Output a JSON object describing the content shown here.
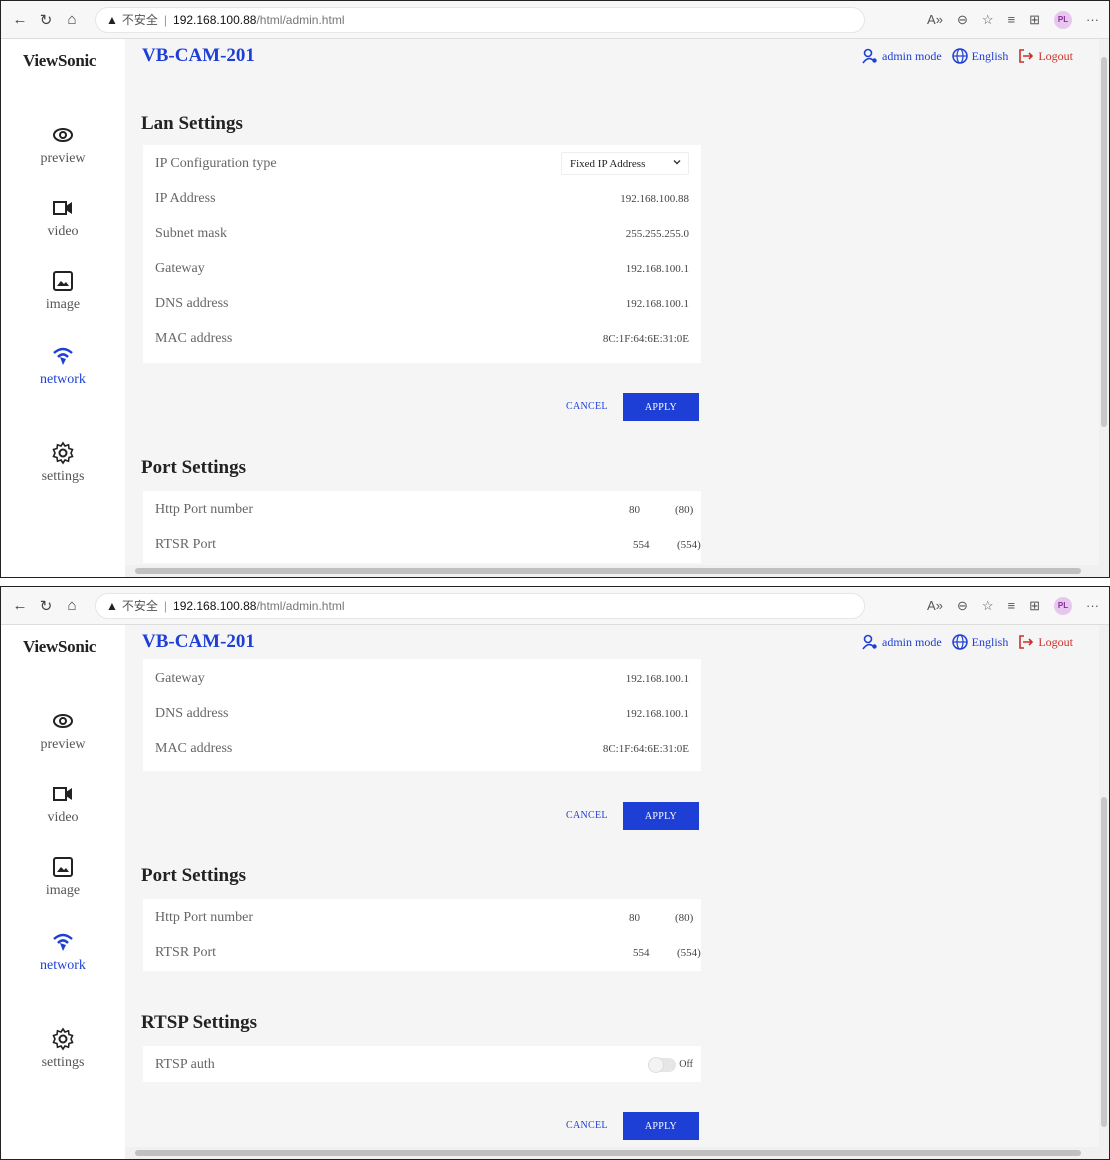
{
  "browser": {
    "warning_icon": "warning-triangle-icon",
    "insecure_label": "不安全",
    "separator": "|",
    "url_host": "192.168.100.88",
    "url_path": "/html/admin.html",
    "avatar_initials": "PL"
  },
  "app": {
    "logo": "ViewSonic",
    "device_title": "VB-CAM-201",
    "admin_mode": "admin mode",
    "language": "English",
    "logout": "Logout",
    "accent_color": "#1e3fd6",
    "logout_color": "#c8312b"
  },
  "sidebar": {
    "items": [
      {
        "label": "preview",
        "icon": "eye-icon"
      },
      {
        "label": "video",
        "icon": "video-camera-icon"
      },
      {
        "label": "image",
        "icon": "image-icon"
      },
      {
        "label": "network",
        "icon": "wifi-icon",
        "active": true
      },
      {
        "label": "settings",
        "icon": "gear-icon"
      }
    ]
  },
  "lan": {
    "title": "Lan Settings",
    "ip_config_label": "IP Configuration type",
    "ip_config_value": "Fixed IP Address",
    "ip_label": "IP Address",
    "ip_value": "192.168.100.88",
    "subnet_label": "Subnet mask",
    "subnet_value": "255.255.255.0",
    "gateway_label": "Gateway",
    "gateway_value": "192.168.100.1",
    "dns_label": "DNS address",
    "dns_value": "192.168.100.1",
    "mac_label": "MAC address",
    "mac_value": "8C:1F:64:6E:31:0E"
  },
  "port": {
    "title": "Port Settings",
    "http_label": "Http Port number",
    "http_value": "80",
    "http_default": "(80)",
    "rtsr_label": "RTSR Port",
    "rtsr_value": "554",
    "rtsr_default": "(554)"
  },
  "rtsp": {
    "title": "RTSP Settings",
    "auth_label": "RTSP auth",
    "auth_state": "Off"
  },
  "buttons": {
    "cancel": "CANCEL",
    "apply": "APPLY"
  }
}
